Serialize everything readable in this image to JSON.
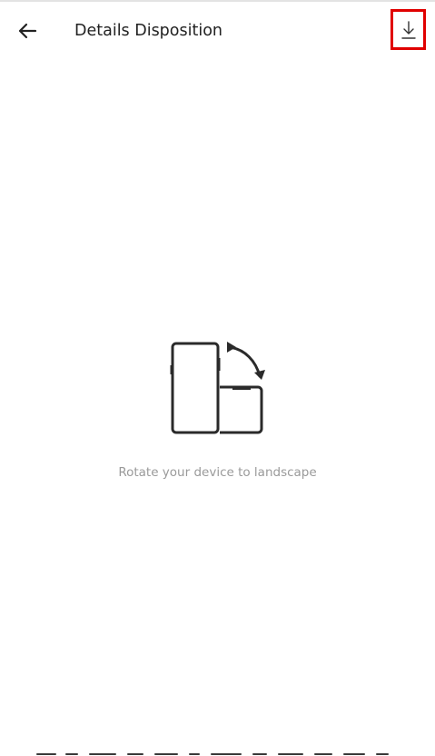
{
  "app_bar": {
    "back_icon": "arrow-left-icon",
    "title": "Details Disposition",
    "download_icon": "download-icon",
    "highlight_color": "#e00000"
  },
  "content": {
    "illustration_icon": "rotate-device-icon",
    "hint": "Rotate your device to landscape"
  },
  "colors": {
    "background": "#ffffff",
    "text_primary": "#222222",
    "text_secondary": "#9a9a9a"
  }
}
